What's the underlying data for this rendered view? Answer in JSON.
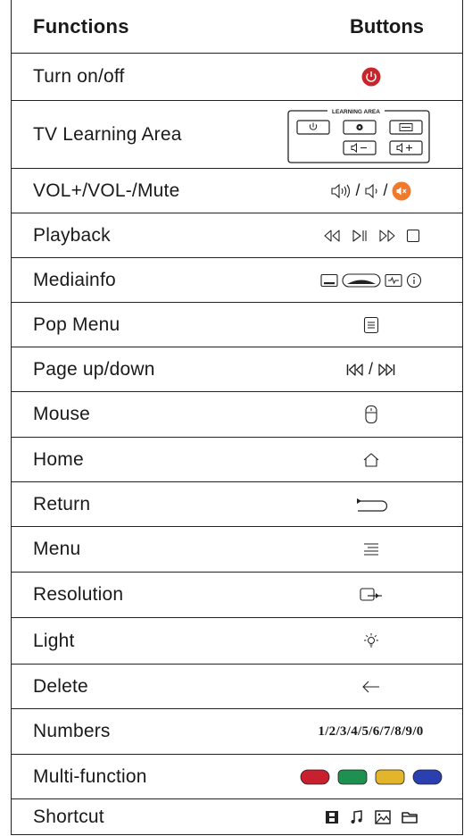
{
  "header": {
    "functions": "Functions",
    "buttons": "Buttons"
  },
  "rows": [
    {
      "function": "Turn on/off",
      "icon": "power-button-icon",
      "color": "#c8262d"
    },
    {
      "function": "TV Learning Area",
      "area_label": "LEARNING AREA",
      "icon": "learning-area-panel"
    },
    {
      "function": "VOL+/VOL-/Mute",
      "separator": "/",
      "icons": [
        "volume-up-icon",
        "volume-down-icon",
        "mute-icon"
      ],
      "mute_color": "#f07a2c"
    },
    {
      "function": "Playback",
      "icons": [
        "rewind-icon",
        "play-pause-icon",
        "fast-forward-icon",
        "stop-icon"
      ]
    },
    {
      "function": "Mediainfo",
      "icons": [
        "subtitle-icon",
        "audio-track-icon",
        "info-panel-icon",
        "info-icon"
      ]
    },
    {
      "function": "Pop Menu",
      "icon": "pop-menu-icon"
    },
    {
      "function": "Page up/down",
      "separator": "/",
      "icons": [
        "page-up-icon",
        "page-down-icon"
      ]
    },
    {
      "function": "Mouse",
      "icon": "mouse-icon"
    },
    {
      "function": "Home",
      "icon": "home-icon"
    },
    {
      "function": "Return",
      "icon": "return-icon"
    },
    {
      "function": "Menu",
      "icon": "menu-icon"
    },
    {
      "function": "Resolution",
      "icon": "resolution-icon"
    },
    {
      "function": "Light",
      "icon": "light-bulb-icon"
    },
    {
      "function": "Delete",
      "icon": "delete-arrow-icon"
    },
    {
      "function": "Numbers",
      "value": "1/2/3/4/5/6/7/8/9/0"
    },
    {
      "function": "Multi-function",
      "colors": [
        "#c8202e",
        "#1e9050",
        "#e3b52a",
        "#2a3fb0"
      ]
    },
    {
      "function": "Shortcut",
      "icons": [
        "film-icon",
        "music-icon",
        "picture-icon",
        "folder-icon"
      ]
    }
  ]
}
